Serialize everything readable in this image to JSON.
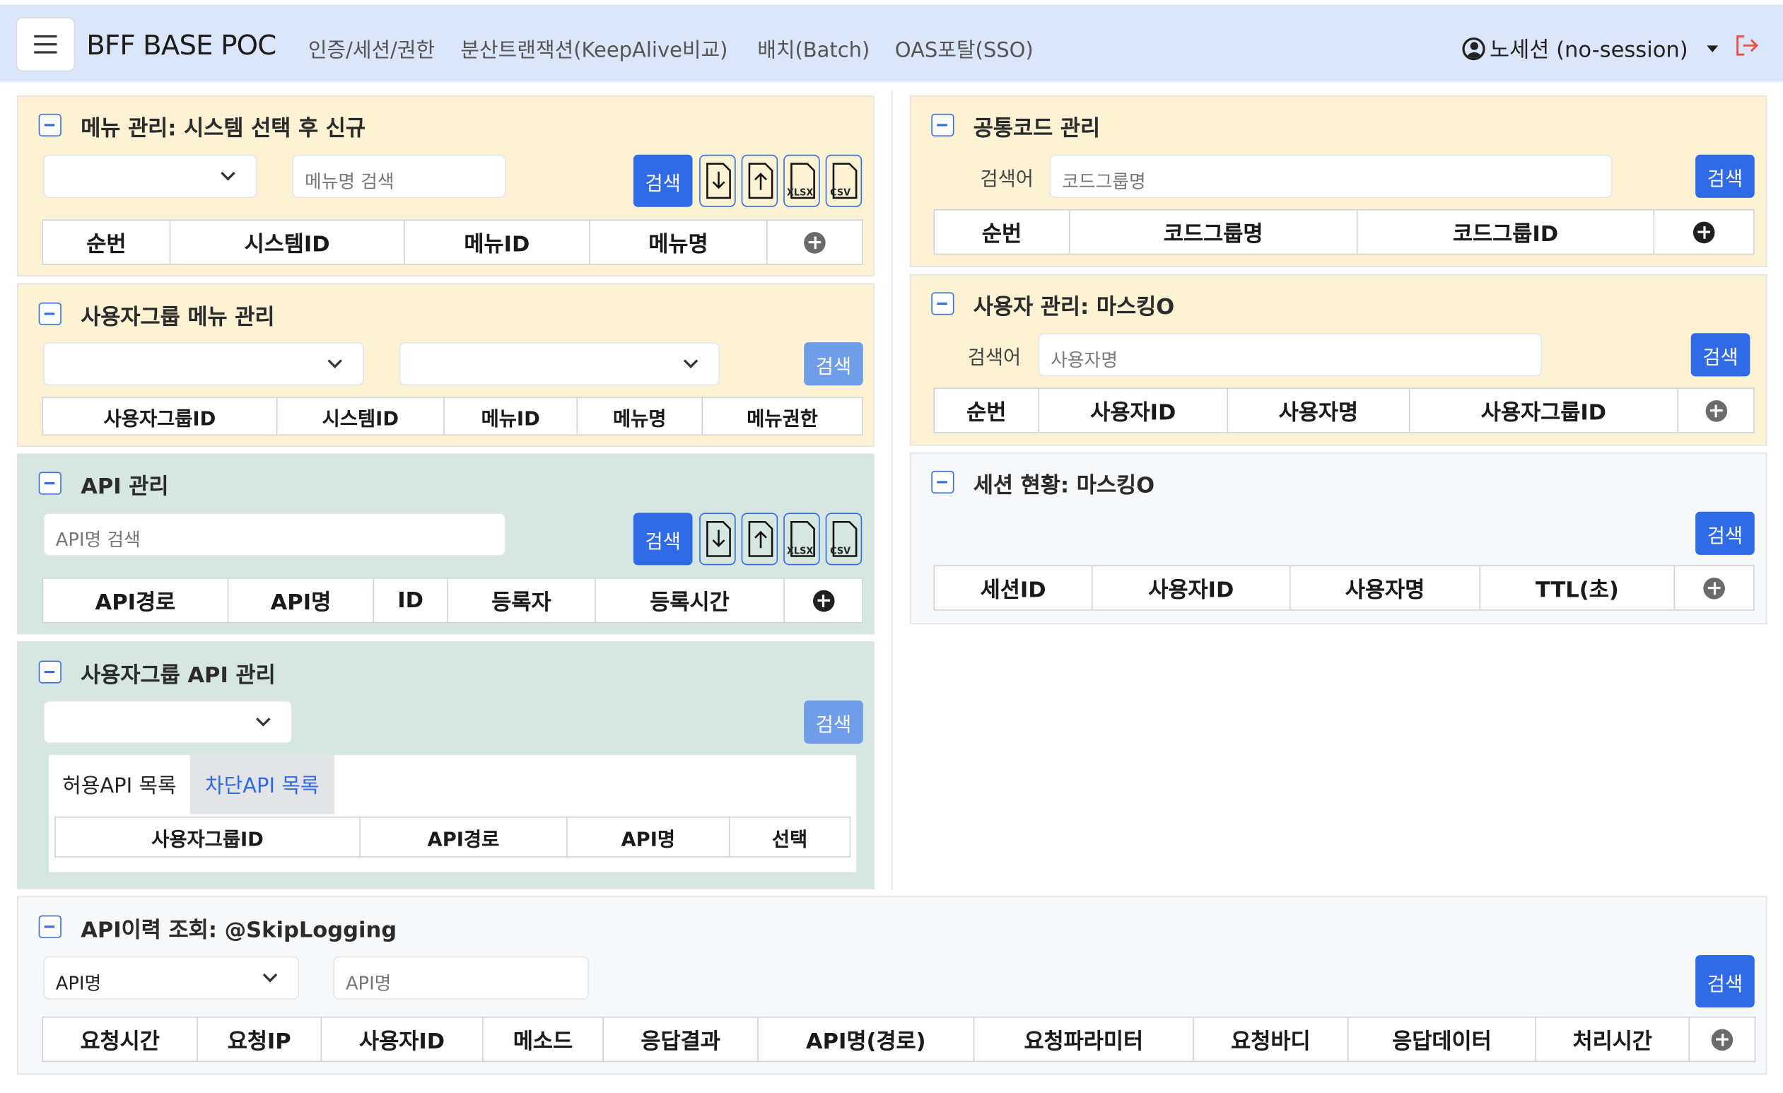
{
  "header": {
    "brand": "BFF BASE POC",
    "nav": [
      "인증/세션/권한",
      "분산트랜잭션(KeepAlive비교)",
      "배치(Batch)",
      "OAS포탈(SSO)"
    ],
    "user": "노세션 (no-session)"
  },
  "common": {
    "search_label": "검색",
    "search_word_label": "검색어"
  },
  "menu_mgmt": {
    "title": "메뉴 관리: 시스템 선택 후 신규",
    "search_placeholder": "메뉴명 검색",
    "columns": [
      "순번",
      "시스템ID",
      "메뉴ID",
      "메뉴명"
    ],
    "file_xlsx": "XLSX",
    "file_csv": "CSV"
  },
  "usergroup_menu": {
    "title": "사용자그룹 메뉴 관리",
    "columns": [
      "사용자그룹ID",
      "시스템ID",
      "메뉴ID",
      "메뉴명",
      "메뉴권한"
    ]
  },
  "api_mgmt": {
    "title": "API 관리",
    "search_placeholder": "API명 검색",
    "columns": [
      "API경로",
      "API명",
      "ID",
      "등록자",
      "등록시간"
    ]
  },
  "usergroup_api": {
    "title": "사용자그룹 API 관리",
    "tabs": [
      "허용API 목록",
      "차단API 목록"
    ],
    "columns": [
      "사용자그룹ID",
      "API경로",
      "API명",
      "선택"
    ]
  },
  "common_code": {
    "title": "공통코드 관리",
    "search_placeholder": "코드그룹명",
    "columns": [
      "순번",
      "코드그룹명",
      "코드그룹ID"
    ]
  },
  "user_mgmt": {
    "title": "사용자 관리: 마스킹O",
    "search_placeholder": "사용자명",
    "columns": [
      "순번",
      "사용자ID",
      "사용자명",
      "사용자그룹ID"
    ]
  },
  "session": {
    "title": "세션 현황: 마스킹O",
    "columns": [
      "세션ID",
      "사용자ID",
      "사용자명",
      "TTL(초)"
    ]
  },
  "api_history": {
    "title": "API이력 조회: @SkipLogging",
    "select_value": "API명",
    "search_placeholder": "API명",
    "columns": [
      "요청시간",
      "요청IP",
      "사용자ID",
      "메소드",
      "응답결과",
      "API명(경로)",
      "요청파라미터",
      "요청바디",
      "응답데이터",
      "처리시간"
    ]
  }
}
